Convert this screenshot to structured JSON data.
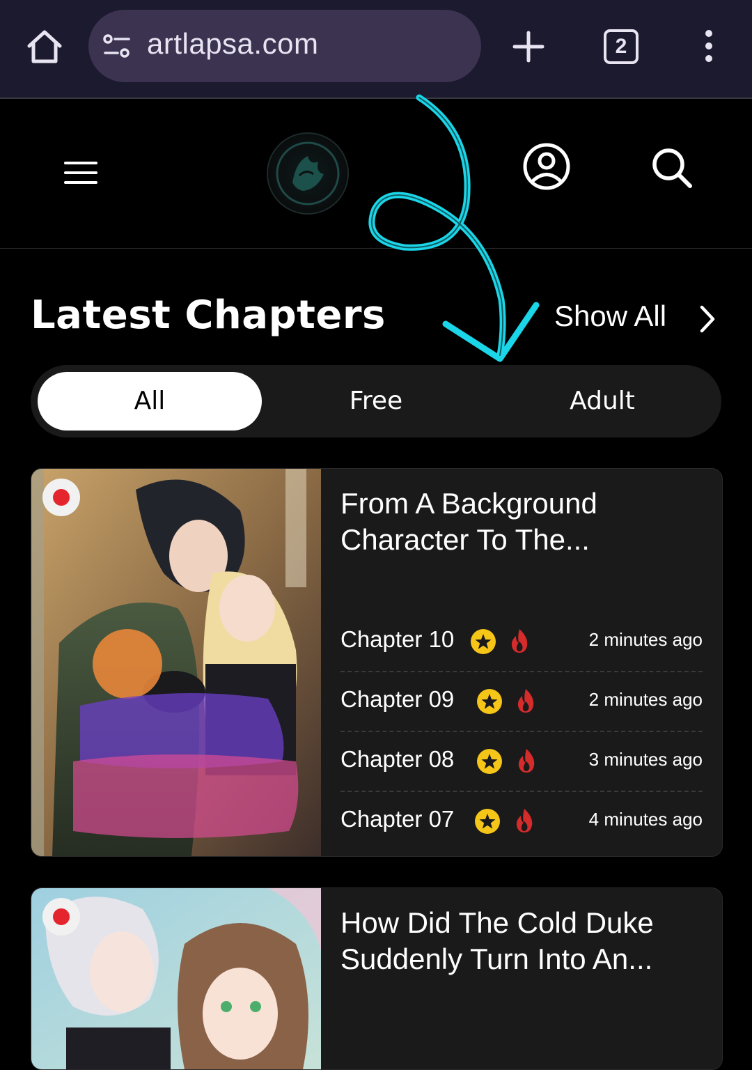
{
  "browser": {
    "url": "artlapsa.com",
    "tab_count": "2"
  },
  "header": {
    "logo_alt": "site-logo"
  },
  "section": {
    "title": "Latest Chapters",
    "show_all": "Show All"
  },
  "filters": [
    {
      "label": "All",
      "active": true
    },
    {
      "label": "Free",
      "active": false
    },
    {
      "label": "Adult",
      "active": false
    }
  ],
  "cards": [
    {
      "title": "From A Background Character To The...",
      "chapters": [
        {
          "label": "Chapter 10",
          "time": "2 minutes ago"
        },
        {
          "label": "Chapter 09",
          "time": "2 minutes ago"
        },
        {
          "label": "Chapter 08",
          "time": "3 minutes ago"
        },
        {
          "label": "Chapter 07",
          "time": "4 minutes ago"
        }
      ]
    },
    {
      "title": "How Did The Cold Duke Suddenly Turn Into An...",
      "chapters": []
    }
  ],
  "colors": {
    "accent_star": "#f5c518",
    "fire": "#d42b2b",
    "scribble": "#1ad6e8",
    "chrome_bg": "#1c1a2e",
    "urlbar_bg": "#3b3350"
  }
}
